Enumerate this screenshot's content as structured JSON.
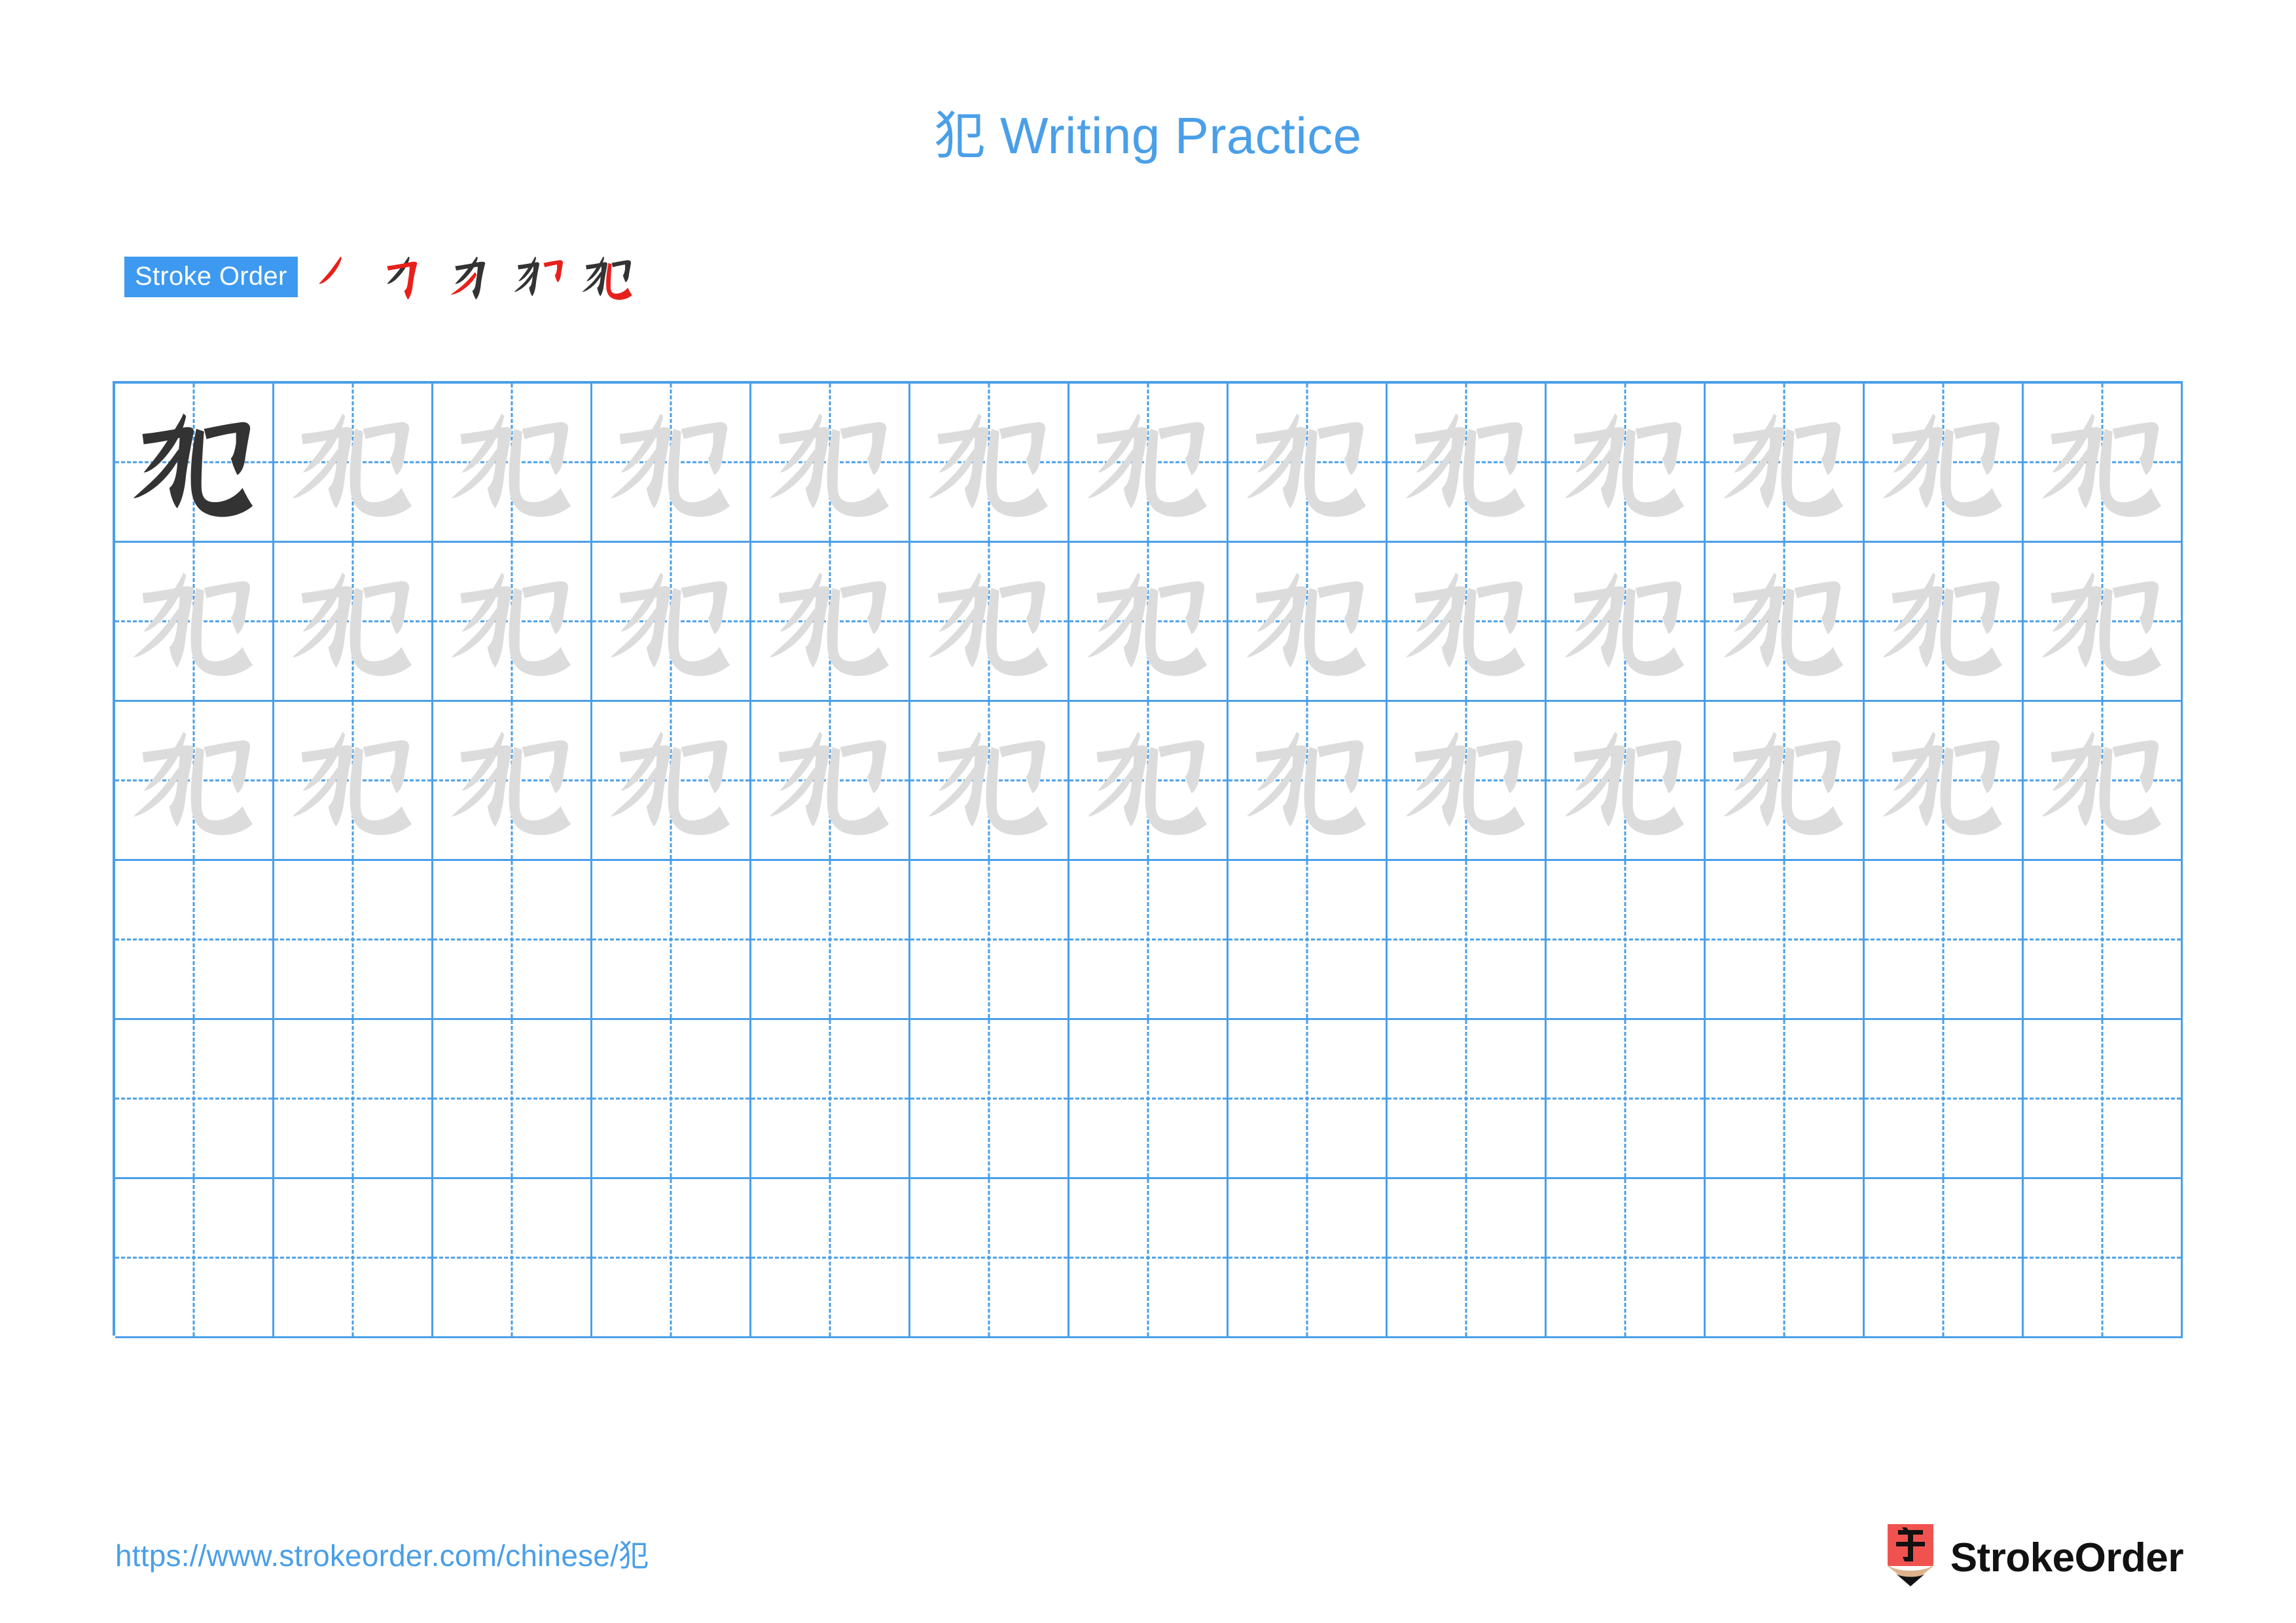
{
  "character": "犯",
  "header": {
    "title_character": "犯",
    "title_text": " Writing Practice",
    "title_full": "犯 Writing Practice",
    "title_color": "#4a9fe8"
  },
  "stroke_order": {
    "badge_label": "Stroke Order",
    "badge_bg": "#3d9af0",
    "badge_text_color": "#ffffff",
    "new_stroke_color": "#e8201c",
    "existing_stroke_color": "#333333",
    "total_strokes": 5,
    "steps": [
      {
        "index": 1,
        "strokes_shown": 1,
        "new_stroke": "丿"
      },
      {
        "index": 2,
        "strokes_shown": 2,
        "new_stroke": "㇉"
      },
      {
        "index": 3,
        "strokes_shown": 3,
        "new_stroke": "丿"
      },
      {
        "index": 4,
        "strokes_shown": 4,
        "new_stroke": "𠃌"
      },
      {
        "index": 5,
        "strokes_shown": 5,
        "new_stroke": "乚"
      }
    ]
  },
  "grid": {
    "columns": 13,
    "rows": 6,
    "border_color": "#4a9fe8",
    "guide_color": "#4a9fe8",
    "example_glyph_color": "#333333",
    "trace_glyph_color": "#dcdcdc",
    "rows_data": [
      {
        "row": 1,
        "cells": [
          "example",
          "trace",
          "trace",
          "trace",
          "trace",
          "trace",
          "trace",
          "trace",
          "trace",
          "trace",
          "trace",
          "trace",
          "trace"
        ]
      },
      {
        "row": 2,
        "cells": [
          "trace",
          "trace",
          "trace",
          "trace",
          "trace",
          "trace",
          "trace",
          "trace",
          "trace",
          "trace",
          "trace",
          "trace",
          "trace"
        ]
      },
      {
        "row": 3,
        "cells": [
          "trace",
          "trace",
          "trace",
          "trace",
          "trace",
          "trace",
          "trace",
          "trace",
          "trace",
          "trace",
          "trace",
          "trace",
          "trace"
        ]
      },
      {
        "row": 4,
        "cells": [
          "empty",
          "empty",
          "empty",
          "empty",
          "empty",
          "empty",
          "empty",
          "empty",
          "empty",
          "empty",
          "empty",
          "empty",
          "empty"
        ]
      },
      {
        "row": 5,
        "cells": [
          "empty",
          "empty",
          "empty",
          "empty",
          "empty",
          "empty",
          "empty",
          "empty",
          "empty",
          "empty",
          "empty",
          "empty",
          "empty"
        ]
      },
      {
        "row": 6,
        "cells": [
          "empty",
          "empty",
          "empty",
          "empty",
          "empty",
          "empty",
          "empty",
          "empty",
          "empty",
          "empty",
          "empty",
          "empty",
          "empty"
        ]
      }
    ]
  },
  "footer": {
    "url": "https://www.strokeorder.com/chinese/犯",
    "url_color": "#4a9fe8",
    "brand_name": "StrokeOrder",
    "logo": {
      "icon_name": "pencil-logo-icon",
      "body_color": "#f0534f",
      "tip_color": "#dcb38c",
      "point_color": "#111111",
      "glyph": "字"
    }
  }
}
